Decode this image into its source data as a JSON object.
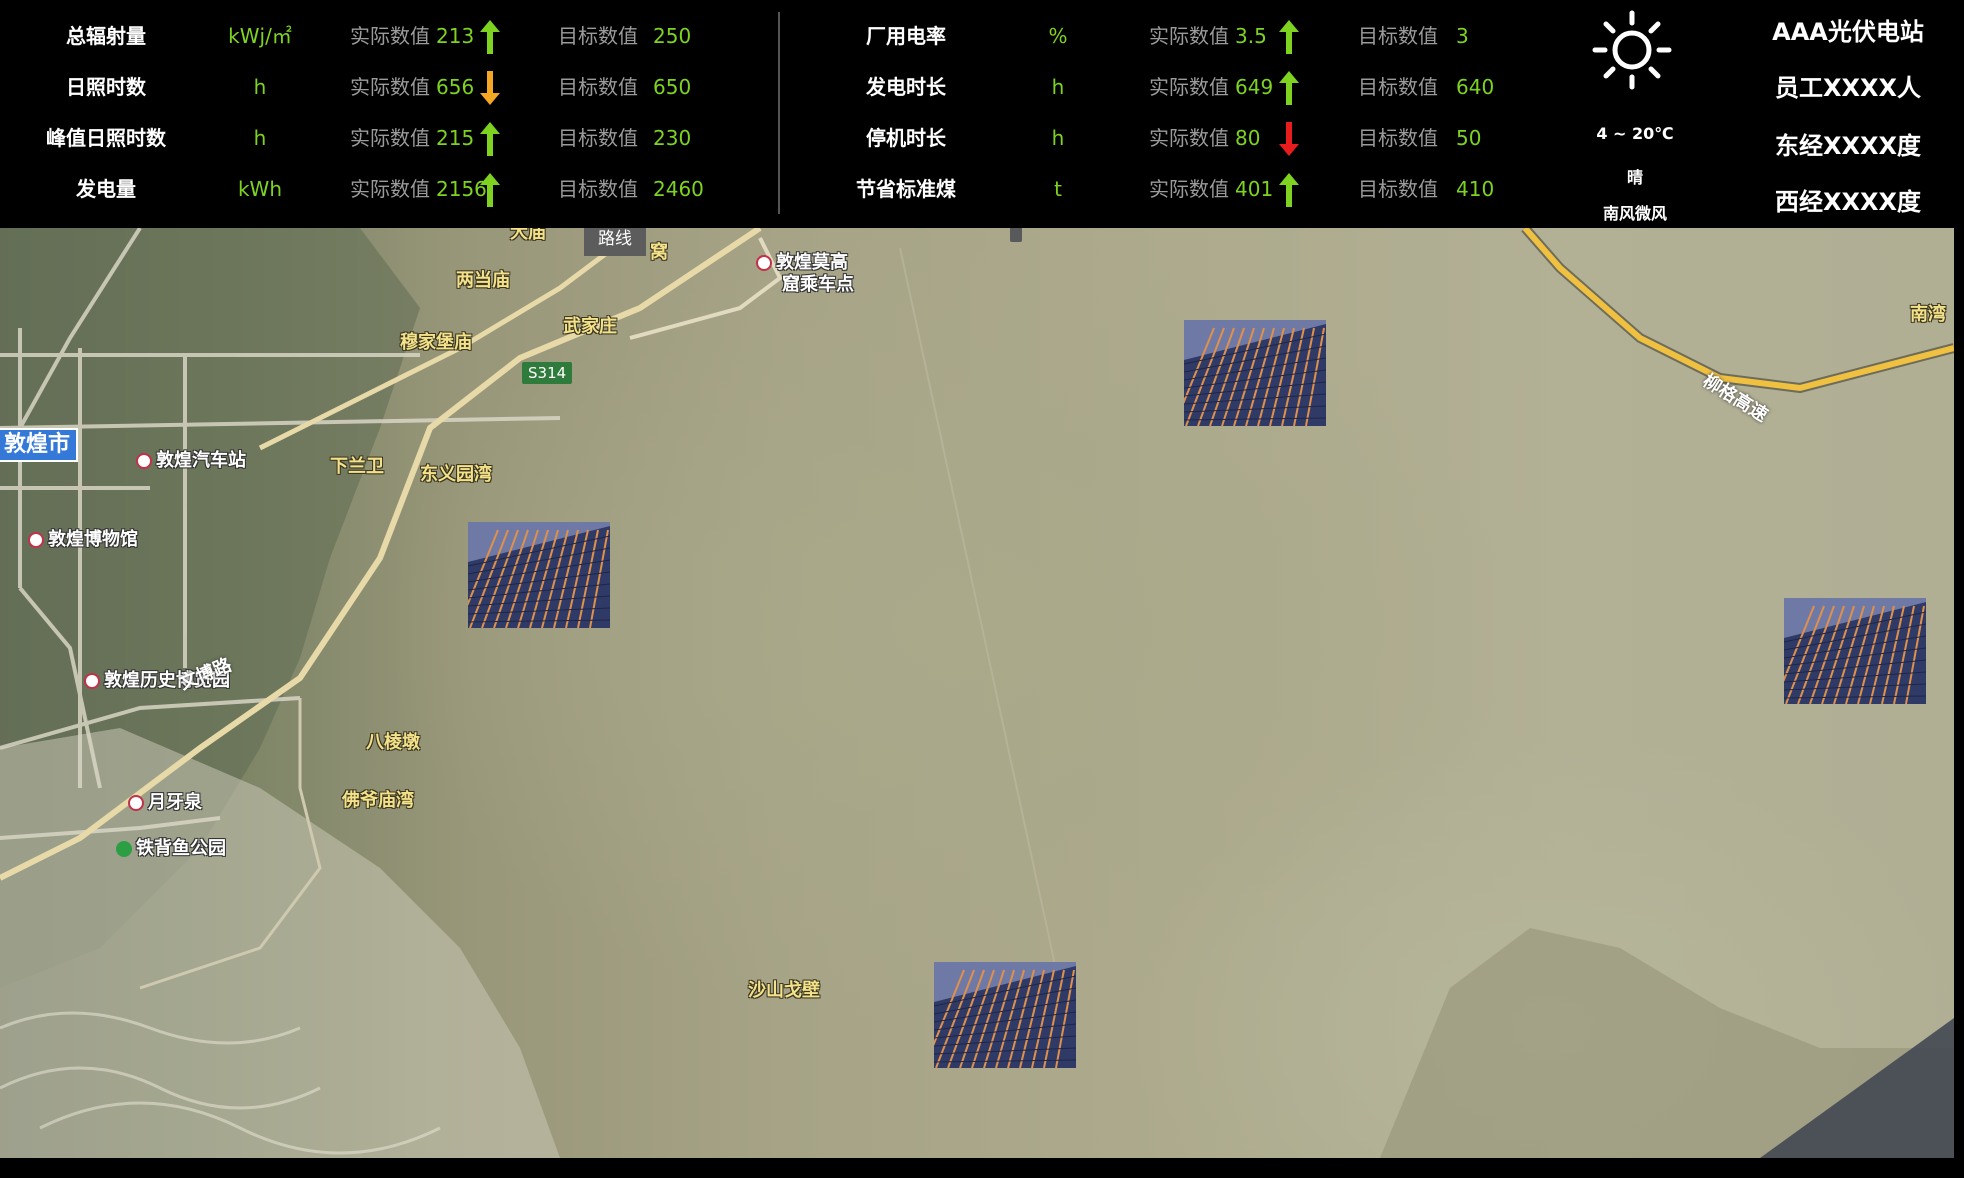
{
  "left_metrics": [
    {
      "label": "总辐射量",
      "unit": "kWj/㎡",
      "actual_label": "实际数值",
      "actual": "213",
      "trend": "up",
      "target_label": "目标数值",
      "target": "250"
    },
    {
      "label": "日照时数",
      "unit": "h",
      "actual_label": "实际数值",
      "actual": "656",
      "trend": "down",
      "target_label": "目标数值",
      "target": "650"
    },
    {
      "label": "峰值日照时数",
      "unit": "h",
      "actual_label": "实际数值",
      "actual": "215",
      "trend": "up",
      "target_label": "目标数值",
      "target": "230"
    },
    {
      "label": "发电量",
      "unit": "kWh",
      "actual_label": "实际数值",
      "actual": "2156",
      "trend": "up",
      "target_label": "目标数值",
      "target": "2460"
    }
  ],
  "right_metrics": [
    {
      "label": "厂用电率",
      "unit": "%",
      "actual_label": "实际数值",
      "actual": "3.5",
      "trend": "up",
      "target_label": "目标数值",
      "target": "3"
    },
    {
      "label": "发电时长",
      "unit": "h",
      "actual_label": "实际数值",
      "actual": "649",
      "trend": "up",
      "target_label": "目标数值",
      "target": "640"
    },
    {
      "label": "停机时长",
      "unit": "h",
      "actual_label": "实际数值",
      "actual": "80",
      "trend": "alert-down",
      "target_label": "目标数值",
      "target": "50"
    },
    {
      "label": "节省标准煤",
      "unit": "t",
      "actual_label": "实际数值",
      "actual": "401",
      "trend": "up",
      "target_label": "目标数值",
      "target": "410"
    }
  ],
  "colors": {
    "up": "#7ed321",
    "down": "#f5a623",
    "alert-down": "#e81c1c",
    "value": "#7ed321",
    "muted": "#9b9b9b"
  },
  "weather": {
    "icon": "sun-icon",
    "temperature": "4 ~ 20℃",
    "condition": "晴",
    "wind": "南风微风"
  },
  "station": {
    "name": "AAA光伏电站",
    "staff": "员工XXXX人",
    "east_longitude": "东经XXXX度",
    "west_longitude": "西经XXXX度"
  },
  "map": {
    "city_badge": "敦煌市",
    "route_chip": "路线",
    "road_number": "S314",
    "highway": "柳格高速",
    "road_name": "文博路",
    "places": {
      "liangdangmiao": "两当庙",
      "mujiabaomiao": "穆家堡庙",
      "wujiazhuang": "武家庄",
      "xialanwei": "下兰卫",
      "dongyiyuanwan": "东义园湾",
      "balengdun": "八棱墩",
      "foyemiaowan": "佛爷庙湾",
      "shashangebi": "沙山戈壁",
      "nanwan": "南湾",
      "wo": "窝",
      "tianmiao": "大庙"
    },
    "pois": {
      "bus_station": "敦煌汽车站",
      "museum": "敦煌博物馆",
      "history_park": "敦煌历史博览园",
      "crescent_spring": "月牙泉",
      "tiebeiyu_park": "铁背鱼公园",
      "mogao_pickup_line1": "敦煌莫高",
      "mogao_pickup_line2": "窟乘车点"
    }
  }
}
